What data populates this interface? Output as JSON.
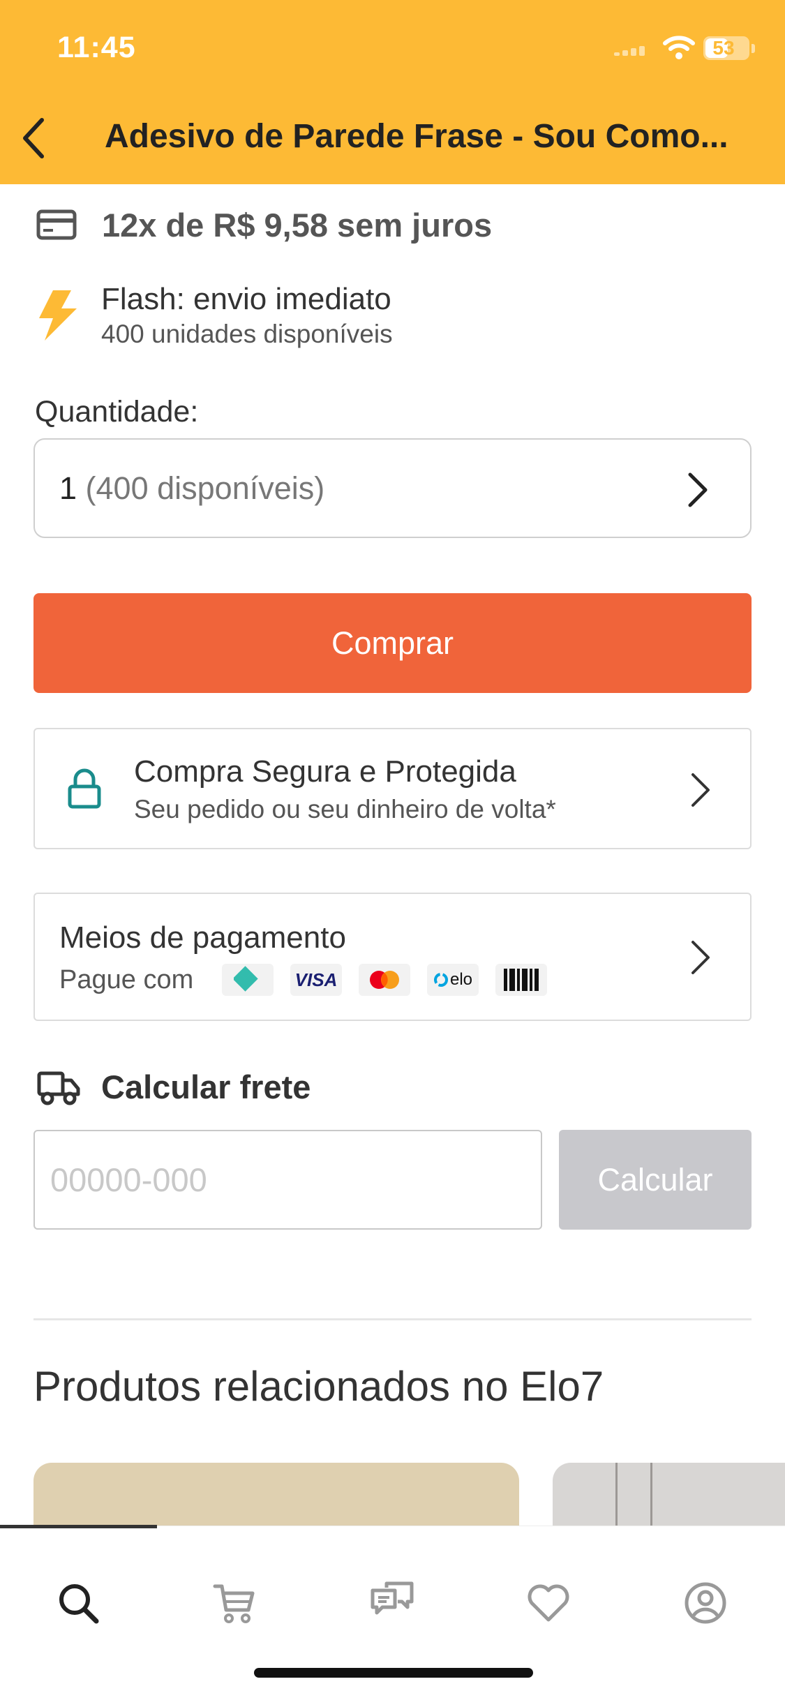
{
  "status_bar": {
    "time": "11:45",
    "battery": "53",
    "battery_level": 0.53
  },
  "nav": {
    "back_icon": "chevron-left-icon",
    "title": "Adesivo de Parede Frase - Sou Como..."
  },
  "installments": {
    "icon": "credit-card-icon",
    "text": "12x de R$ 9,58 sem juros"
  },
  "flash": {
    "icon": "lightning-icon",
    "title": "Flash: envio imediato",
    "subtitle": "400 unidades disponíveis"
  },
  "quantity": {
    "label": "Quantidade:",
    "value": "1",
    "available": "(400 disponíveis)"
  },
  "buy_button": {
    "label": "Comprar",
    "color": "#F0643A"
  },
  "secure_purchase": {
    "icon": "lock-icon",
    "title": "Compra Segura e Protegida",
    "subtitle": "Seu pedido ou seu dinheiro de volta*"
  },
  "payment": {
    "title": "Meios de pagamento",
    "pay_with": "Pague com",
    "methods": [
      "pix-icon",
      "visa-icon",
      "mastercard-icon",
      "elo-icon",
      "boleto-icon"
    ],
    "visa_text": "VISA",
    "elo_text": "elo"
  },
  "freight": {
    "icon": "truck-icon",
    "title": "Calcular frete",
    "placeholder": "00000-000",
    "button": "Calcular"
  },
  "related": {
    "title": "Produtos relacionados no Elo7"
  },
  "tab_bar": {
    "tabs": [
      "search-icon",
      "cart-icon",
      "chat-icon",
      "heart-icon",
      "profile-icon"
    ],
    "active": "search-icon"
  },
  "colors": {
    "header": "#FDBA35",
    "accent": "#F0643A",
    "secure": "#1A8C8C",
    "flash": "#FDBA35"
  }
}
